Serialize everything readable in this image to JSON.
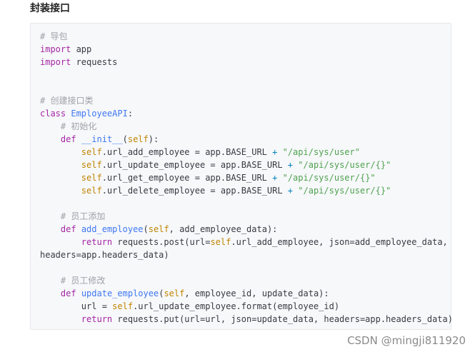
{
  "heading": "封装接口",
  "code": {
    "lines": [
      [
        {
          "t": "# 导包",
          "c": "c"
        }
      ],
      [
        {
          "t": "import",
          "c": "k"
        },
        {
          "t": " app",
          "c": "n"
        }
      ],
      [
        {
          "t": "import",
          "c": "k"
        },
        {
          "t": " requests",
          "c": "n"
        }
      ],
      [],
      [],
      [
        {
          "t": "# 创建接口类",
          "c": "c"
        }
      ],
      [
        {
          "t": "class",
          "c": "k"
        },
        {
          "t": " ",
          "c": "n"
        },
        {
          "t": "EmployeeAPI",
          "c": "f"
        },
        {
          "t": ":",
          "c": "n"
        }
      ],
      [
        {
          "t": "    # 初始化",
          "c": "c"
        }
      ],
      [
        {
          "t": "    ",
          "c": "n"
        },
        {
          "t": "def",
          "c": "k"
        },
        {
          "t": " ",
          "c": "n"
        },
        {
          "t": "__init__",
          "c": "f"
        },
        {
          "t": "(",
          "c": "n"
        },
        {
          "t": "self",
          "c": "b"
        },
        {
          "t": "):",
          "c": "n"
        }
      ],
      [
        {
          "t": "        ",
          "c": "n"
        },
        {
          "t": "self",
          "c": "b"
        },
        {
          "t": ".url_add_employee = app.BASE_URL ",
          "c": "n"
        },
        {
          "t": "+",
          "c": "o"
        },
        {
          "t": " ",
          "c": "n"
        },
        {
          "t": "\"/api/sys/user\"",
          "c": "s"
        }
      ],
      [
        {
          "t": "        ",
          "c": "n"
        },
        {
          "t": "self",
          "c": "b"
        },
        {
          "t": ".url_update_employee = app.BASE_URL ",
          "c": "n"
        },
        {
          "t": "+",
          "c": "o"
        },
        {
          "t": " ",
          "c": "n"
        },
        {
          "t": "\"/api/sys/user/{}\"",
          "c": "s"
        }
      ],
      [
        {
          "t": "        ",
          "c": "n"
        },
        {
          "t": "self",
          "c": "b"
        },
        {
          "t": ".url_get_employee = app.BASE_URL ",
          "c": "n"
        },
        {
          "t": "+",
          "c": "o"
        },
        {
          "t": " ",
          "c": "n"
        },
        {
          "t": "\"/api/sys/user/{}\"",
          "c": "s"
        }
      ],
      [
        {
          "t": "        ",
          "c": "n"
        },
        {
          "t": "self",
          "c": "b"
        },
        {
          "t": ".url_delete_employee = app.BASE_URL ",
          "c": "n"
        },
        {
          "t": "+",
          "c": "o"
        },
        {
          "t": " ",
          "c": "n"
        },
        {
          "t": "\"/api/sys/user/{}\"",
          "c": "s"
        }
      ],
      [],
      [
        {
          "t": "    # 员工添加",
          "c": "c"
        }
      ],
      [
        {
          "t": "    ",
          "c": "n"
        },
        {
          "t": "def",
          "c": "k"
        },
        {
          "t": " ",
          "c": "n"
        },
        {
          "t": "add_employee",
          "c": "f"
        },
        {
          "t": "(",
          "c": "n"
        },
        {
          "t": "self",
          "c": "b"
        },
        {
          "t": ", add_employee_data):",
          "c": "n"
        }
      ],
      [
        {
          "t": "        ",
          "c": "n"
        },
        {
          "t": "return",
          "c": "k"
        },
        {
          "t": " requests.post(url=",
          "c": "n"
        },
        {
          "t": "self",
          "c": "b"
        },
        {
          "t": ".url_add_employee, json=add_employee_data,",
          "c": "n"
        }
      ],
      [
        {
          "t": "headers=app.headers_data)",
          "c": "n"
        }
      ],
      [],
      [
        {
          "t": "    # 员工修改",
          "c": "c"
        }
      ],
      [
        {
          "t": "    ",
          "c": "n"
        },
        {
          "t": "def",
          "c": "k"
        },
        {
          "t": " ",
          "c": "n"
        },
        {
          "t": "update_employee",
          "c": "f"
        },
        {
          "t": "(",
          "c": "n"
        },
        {
          "t": "self",
          "c": "b"
        },
        {
          "t": ", employee_id, update_data):",
          "c": "n"
        }
      ],
      [
        {
          "t": "        url = ",
          "c": "n"
        },
        {
          "t": "self",
          "c": "b"
        },
        {
          "t": ".url_update_employee.format(employee_id)",
          "c": "n"
        }
      ],
      [
        {
          "t": "        ",
          "c": "n"
        },
        {
          "t": "return",
          "c": "k"
        },
        {
          "t": " requests.put(url=url, json=update_data, headers=app.headers_data)",
          "c": "n"
        }
      ]
    ]
  },
  "watermark": "CSDN @mingji811920"
}
